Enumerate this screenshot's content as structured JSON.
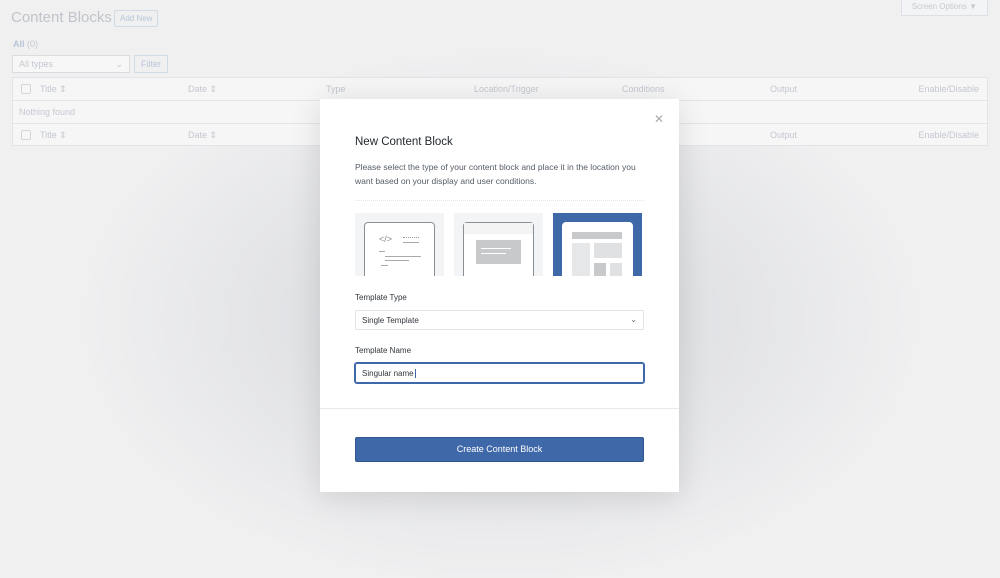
{
  "page": {
    "title": "Content Blocks",
    "add_new": "Add New",
    "screen_options": "Screen Options ▼",
    "all_label": "All",
    "all_count": "(0)",
    "type_filter": "All types",
    "filter": "Filter",
    "columns": [
      "Title",
      "Date",
      "Type",
      "Location/Trigger",
      "Conditions",
      "Output",
      "Enable/Disable"
    ],
    "empty": "Nothing found"
  },
  "modal": {
    "title": "New Content Block",
    "description": "Please select the type of your content block and place it in the location you want based on your display and user conditions.",
    "template_types": [
      "code",
      "popup",
      "single-template"
    ],
    "selected_type": "single-template",
    "template_type_label": "Template Type",
    "template_type_value": "Single Template",
    "template_name_label": "Template Name",
    "template_name_value": "Singular name",
    "submit": "Create Content Block",
    "accent": "#3f68a8"
  }
}
